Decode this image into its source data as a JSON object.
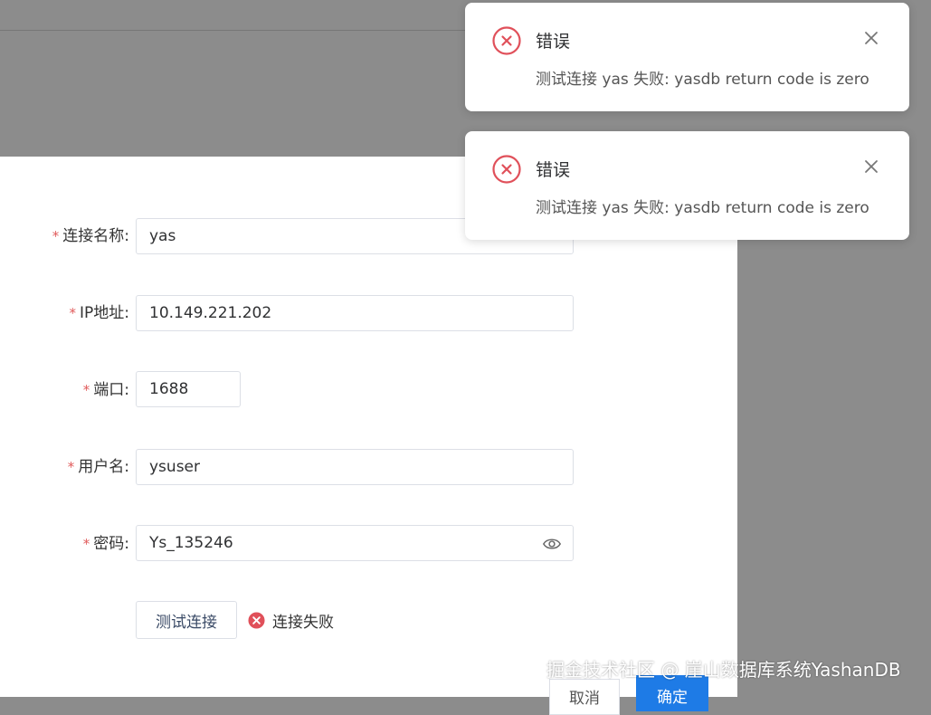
{
  "form": {
    "name_label": "连接名称:",
    "name_value": "yas",
    "ip_label": "IP地址:",
    "ip_value": "10.149.221.202",
    "port_label": "端口:",
    "port_value": "1688",
    "user_label": "用户名:",
    "user_value": "ysuser",
    "password_label": "密码:",
    "password_value": "Ys_135246",
    "required_mark": "*"
  },
  "actions": {
    "test_label": "测试连接",
    "status_text": "连接失败",
    "cancel_label": "取消",
    "ok_label": "确定"
  },
  "notifications": [
    {
      "title": "错误",
      "message": "测试连接 yas 失败: yasdb return code is zero"
    },
    {
      "title": "错误",
      "message": "测试连接 yas 失败: yasdb return code is zero"
    }
  ],
  "watermark": "掘金技术社区 @ 崖山数据库系统YashanDB",
  "colors": {
    "error": "#e0505a",
    "primary": "#1e7be6",
    "required": "#e05a5a"
  }
}
